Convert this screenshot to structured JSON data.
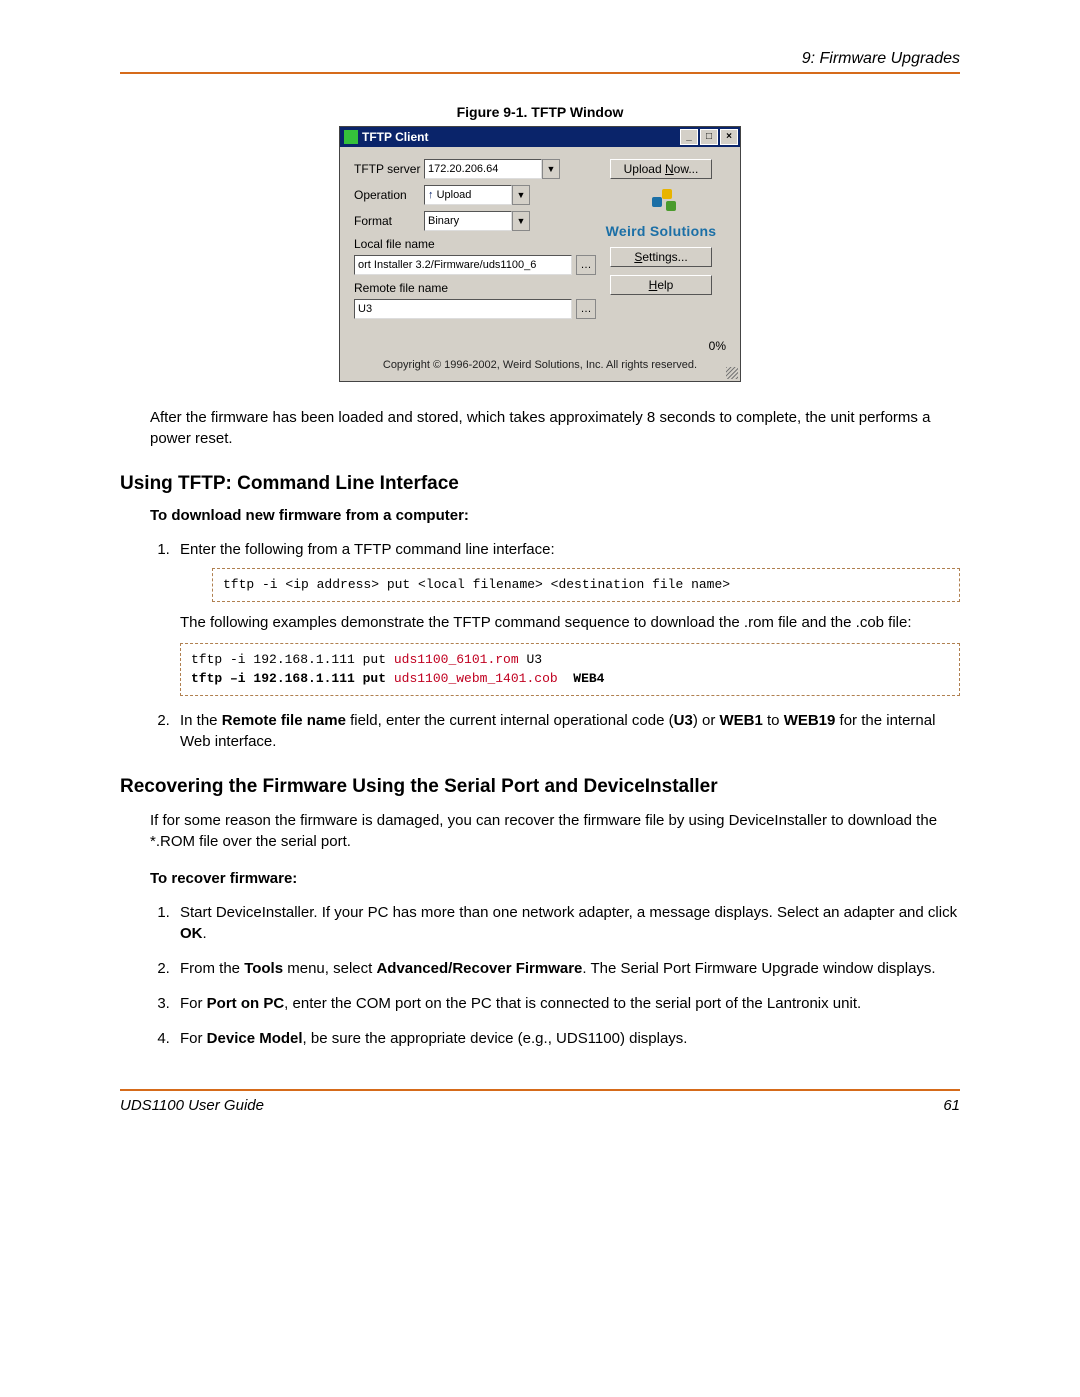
{
  "header": {
    "section": "9: Firmware Upgrades"
  },
  "figure": {
    "caption": "Figure 9-1. TFTP Window"
  },
  "tftp": {
    "title": "TFTP Client",
    "labels": {
      "server": "TFTP server",
      "operation": "Operation",
      "format": "Format",
      "localfile": "Local file name",
      "remotefile": "Remote file name"
    },
    "values": {
      "server": "172.20.206.64",
      "operation": "Upload",
      "format": "Binary",
      "localfile": "ort Installer 3.2/Firmware/uds1100_6",
      "remotefile": "U3",
      "progress": "0%"
    },
    "buttons": {
      "upload": "Upload Now...",
      "settings": "Settings...",
      "help": "Help"
    },
    "brand": "Weird Solutions",
    "copyright": "Copyright © 1996-2002, Weird Solutions, Inc. All rights reserved."
  },
  "para_after_fig": "After the firmware has been loaded and stored, which takes approximately 8 seconds to complete, the unit performs a power reset.",
  "h2a": "Using TFTP: Command Line Interface",
  "sub1": "To download new firmware from a computer:",
  "step1": "Enter the following from a TFTP command line interface:",
  "code1": "tftp -i <ip address> put <local filename> <destination file name>",
  "para_examples": "The following examples demonstrate the TFTP command sequence to download the .rom file and the .cob file:",
  "code2": {
    "line1a": "tftp -i 192.168.1.111 put ",
    "line1b": "uds1100_6101.rom",
    "line1c": " U3",
    "line2a": "tftp –i 192.168.1.111 put ",
    "line2b": "uds1100_webm_1401.cob",
    "line2c": "  WEB4"
  },
  "step2": {
    "a": "In the ",
    "b": "Remote file name",
    "c": " field, enter the current internal operational code (",
    "d": "U3",
    "e": ") or ",
    "f": "WEB1",
    "g": " to ",
    "h": "WEB19",
    "i": " for the internal Web interface."
  },
  "h2b": "Recovering the Firmware Using the Serial Port and DeviceInstaller",
  "para_recover": "If for some reason the firmware is damaged, you can recover the firmware file by using DeviceInstaller to download the *.ROM file over the serial port.",
  "sub2": "To recover firmware:",
  "rsteps": {
    "s1a": "Start DeviceInstaller. If your PC has more than one network adapter, a message displays. Select an adapter and click ",
    "s1b": "OK",
    "s1c": ".",
    "s2a": "From the ",
    "s2b": "Tools",
    "s2c": " menu, select ",
    "s2d": "Advanced/Recover Firmware",
    "s2e": ". The Serial Port Firmware Upgrade window displays.",
    "s3a": "For ",
    "s3b": "Port on PC",
    "s3c": ", enter the COM port on the PC that is connected to the serial port of the Lantronix unit.",
    "s4a": "For ",
    "s4b": "Device Model",
    "s4c": ", be sure the appropriate device (e.g., UDS1100) displays."
  },
  "footer": {
    "left": "UDS1100 User Guide",
    "right": "61"
  }
}
